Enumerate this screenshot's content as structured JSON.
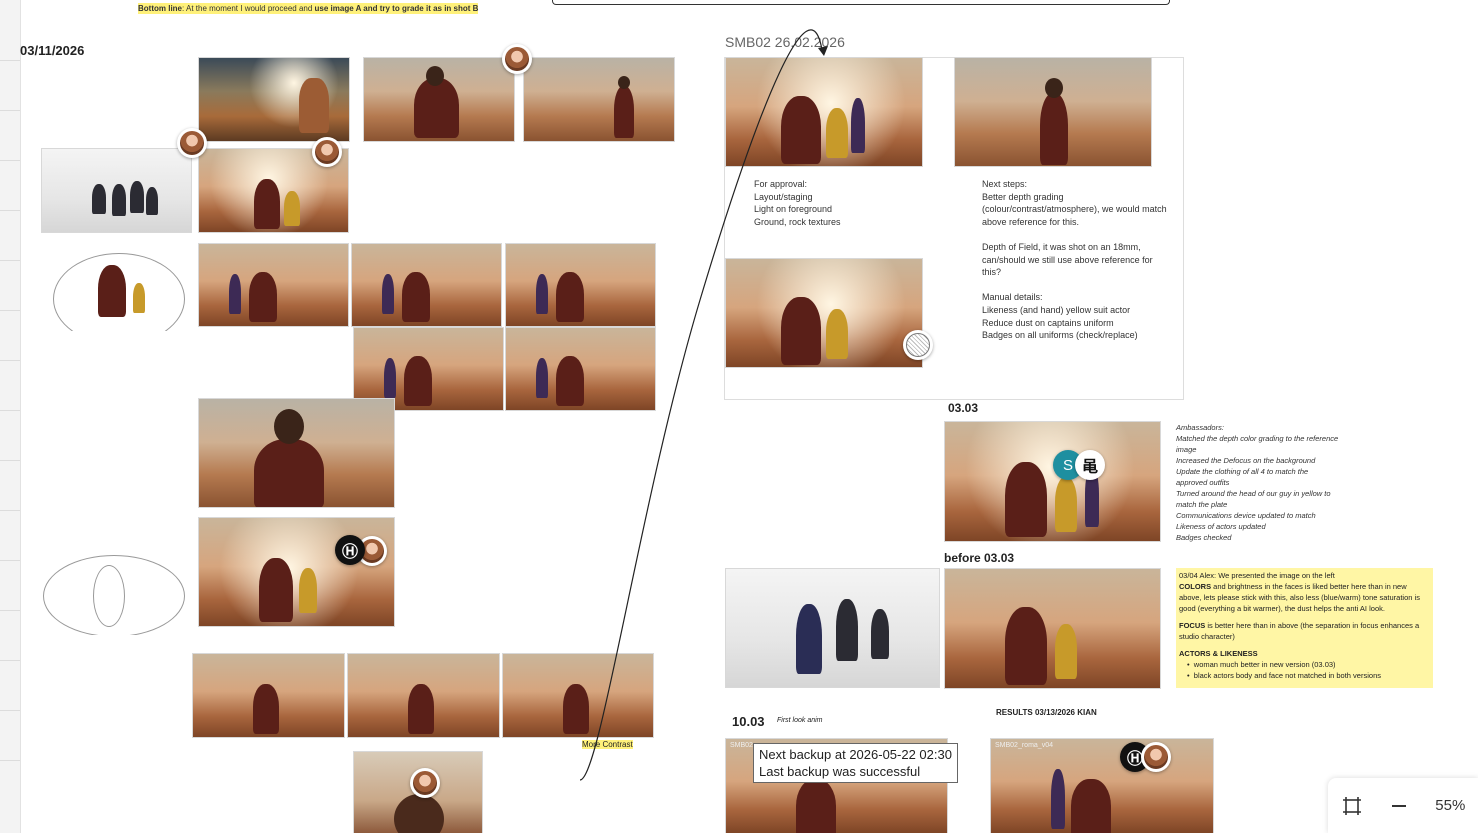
{
  "header": {
    "bottom_line_label": "Bottom line",
    "bottom_line_text": ": At the moment I would proceed and ",
    "bottom_line_bold": "use image A and try to grade it as in shot B"
  },
  "left_column": {
    "date": "03/11/2026",
    "more_contrast": "More Contrast"
  },
  "smb02": {
    "title": "SMB02 26.02.2026",
    "approval_title": "For approval:",
    "approval_items": [
      "Layout/staging",
      "Light on foreground",
      "Ground, rock textures"
    ],
    "next_steps": "Next steps:\nBetter depth grading\n(colour/contrast/atmosphere), we would match\nabove reference for this.\n\nDepth of Field, it was shot on an 18mm,\ncan/should we still use above reference for\nthis?\n\nManual details:\nLikeness (and hand) yellow suit actor\nReduce dust on captains uniform\nBadges on all uniforms (check/replace)"
  },
  "section_0303": {
    "title": "03.03",
    "notes": "Ambassadors:\nMatched the depth color grading to the reference\nimage\nIncreased the Defocus on the background\nUpdate the clothing of all 4 to match the\napproved outfits\nTurned around the head of our guy in yellow to\nmatch the plate\nCommunications device updated to match\nLikeness of actors updated\nBadges checked"
  },
  "before_0303": {
    "title": "before 03.03",
    "note_line1": "03/04 Alex: We presented the image on the left",
    "colors_label": "COLORS",
    "colors_text": " and brightness in the faces is liked better here than in new above, lets please stick with this, also less (blue/warm) tone saturation is good (everything a bit warmer), the dust helps the anti AI look.",
    "focus_label": "FOCUS",
    "focus_text": " is better here than in above (the separation in focus enhances a studio character)",
    "actors_label": "ACTORS & LIKENESS",
    "bullets": [
      "woman much better in new version (03.03)",
      "black actors body and face not matched in both versions"
    ]
  },
  "section_1003": {
    "title": "10.03",
    "subtitle": "First look anim",
    "thumb_caption": "SMB02",
    "results_title": "RESULTS 03/13/2026 KIAN",
    "results_caption": "SMB02_roma_v04"
  },
  "tooltip": {
    "line1": "Next backup at 2026-05-22 02:30",
    "line2": "Last backup was successful"
  },
  "avatars": {
    "teal_letter": "S",
    "logo_glyph": "Ⓗ",
    "scribble_glyph": "⻪"
  },
  "zoom": {
    "level": "55%",
    "fit_icon": "fit-to-screen-icon",
    "zoom_out_icon": "zoom-out-icon"
  },
  "colors": {
    "highlight": "#fff17a",
    "sticky": "#fff6a5",
    "teal_avatar": "#1e8fa0"
  }
}
